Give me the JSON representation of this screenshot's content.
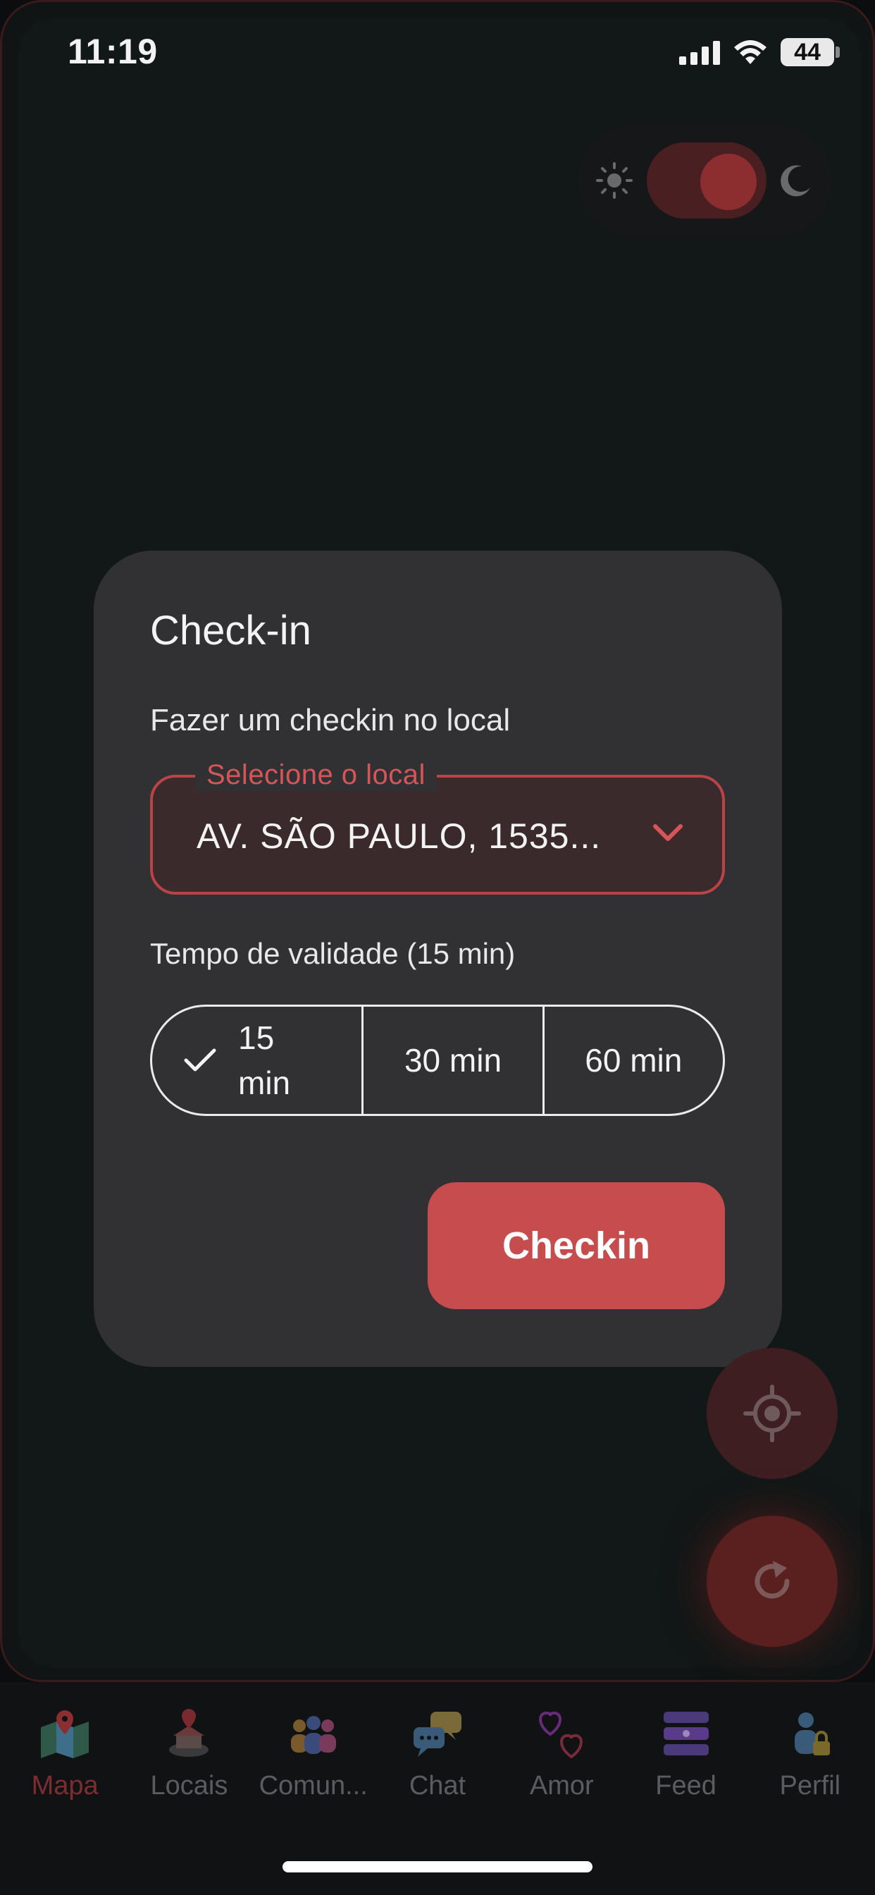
{
  "status_bar": {
    "time": "11:19",
    "battery": "44"
  },
  "theme_toggle": {
    "mode": "dark"
  },
  "dialog": {
    "title": "Check-in",
    "subtitle": "Fazer um checkin no local",
    "select": {
      "label": "Selecione o local",
      "value": "AV. SÃO PAULO, 1535..."
    },
    "validity_label": "Tempo de validade (15 min)",
    "durations": [
      {
        "label": "15 min",
        "selected": true
      },
      {
        "label": "30 min",
        "selected": false
      },
      {
        "label": "60 min",
        "selected": false
      }
    ],
    "submit_label": "Checkin"
  },
  "bottom_nav": {
    "items": [
      {
        "label": "Mapa",
        "icon": "map-icon",
        "active": true
      },
      {
        "label": "Locais",
        "icon": "places-icon",
        "active": false
      },
      {
        "label": "Comun...",
        "icon": "community-icon",
        "active": false
      },
      {
        "label": "Chat",
        "icon": "chat-icon",
        "active": false
      },
      {
        "label": "Amor",
        "icon": "hearts-icon",
        "active": false
      },
      {
        "label": "Feed",
        "icon": "feed-icon",
        "active": false
      },
      {
        "label": "Perfil",
        "icon": "profile-lock-icon",
        "active": false
      }
    ]
  },
  "colors": {
    "accent": "#c74c4e",
    "dialog_bg": "#313133",
    "nav_active": "#7d2d30"
  }
}
